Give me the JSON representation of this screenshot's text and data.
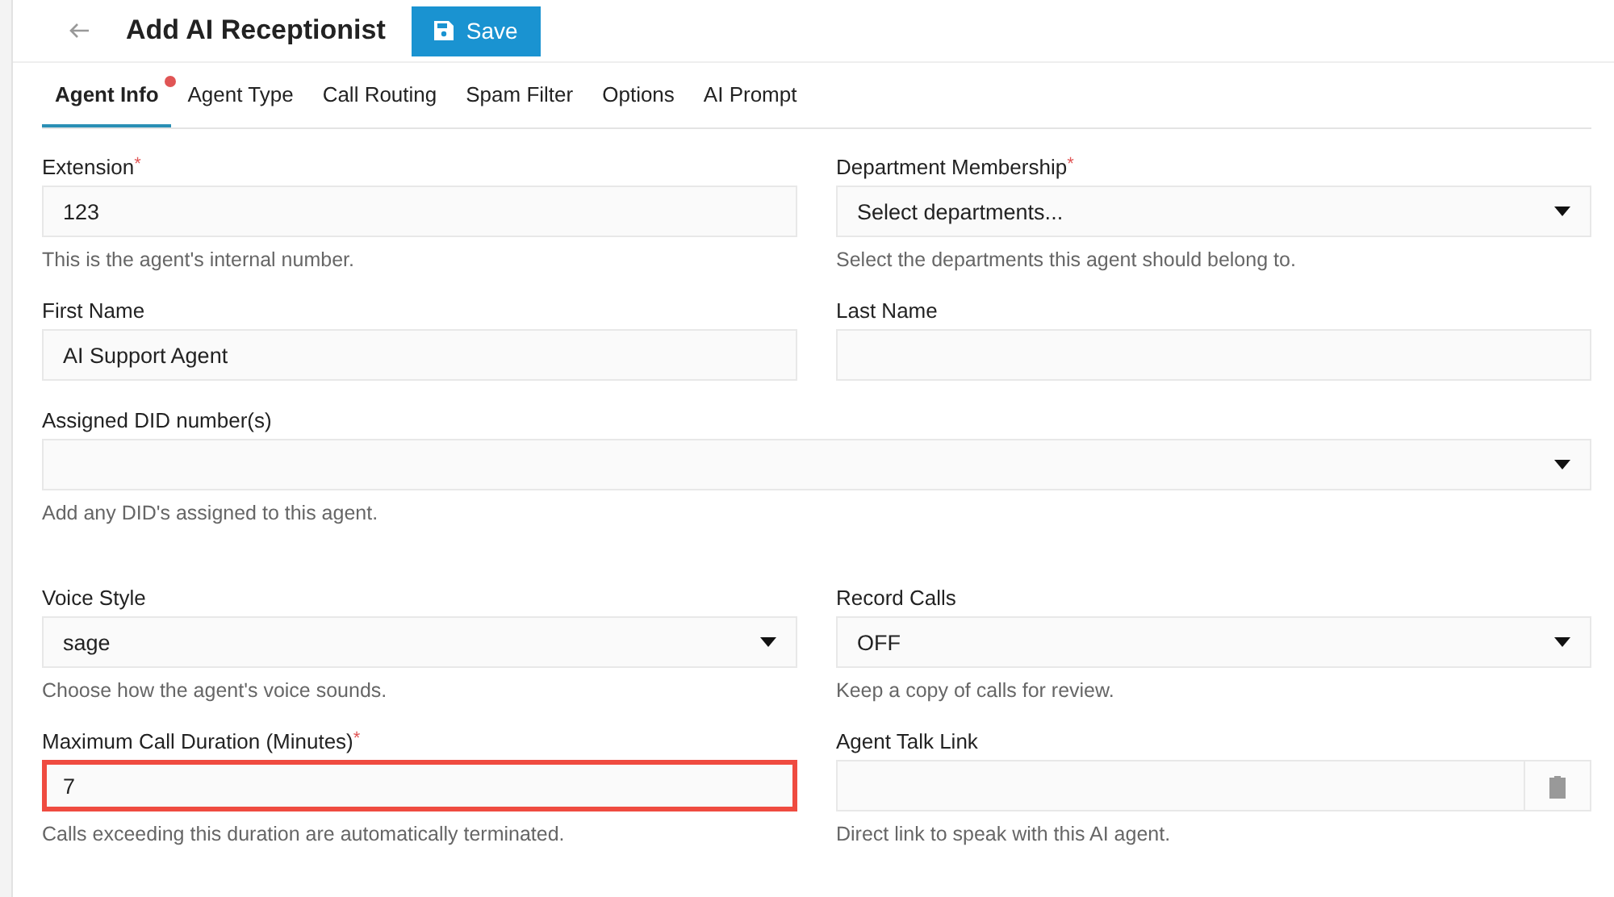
{
  "header": {
    "title": "Add AI Receptionist",
    "save_label": "Save"
  },
  "tabs": [
    {
      "label": "Agent Info",
      "selected": true,
      "alert": true
    },
    {
      "label": "Agent Type",
      "selected": false,
      "alert": false
    },
    {
      "label": "Call Routing",
      "selected": false,
      "alert": false
    },
    {
      "label": "Spam Filter",
      "selected": false,
      "alert": false
    },
    {
      "label": "Options",
      "selected": false,
      "alert": false
    },
    {
      "label": "AI Prompt",
      "selected": false,
      "alert": false
    }
  ],
  "rows": [
    {
      "fields": [
        {
          "kind": "input",
          "label": "Extension",
          "required_mark": "*",
          "value": "123",
          "help": "This is the agent's internal number.",
          "invalid": false
        },
        {
          "kind": "select",
          "label": "Department Membership",
          "required_mark": "*",
          "value": "Select departments...",
          "help": "Select the departments this agent should belong to.",
          "invalid": false
        }
      ]
    },
    {
      "fields": [
        {
          "kind": "input",
          "label": "First Name",
          "value": "AI Support Agent",
          "invalid": false
        },
        {
          "kind": "input",
          "label": "Last Name",
          "invalid": false
        }
      ]
    },
    {
      "fields": [
        {
          "kind": "select",
          "label": "Assigned DID number(s)",
          "help": "Add any DID's assigned to this agent.",
          "invalid": false
        }
      ]
    },
    {
      "fields": [
        {
          "kind": "select",
          "label": "Voice Style",
          "value": "sage",
          "help": "Choose how the agent's voice sounds.",
          "invalid": false
        },
        {
          "kind": "select",
          "label": "Record Calls",
          "value": "OFF",
          "help": "Keep a copy of calls for review.",
          "invalid": false
        }
      ]
    },
    {
      "fields": [
        {
          "kind": "input",
          "label": "Maximum Call Duration (Minutes)",
          "required_mark": "*",
          "value": "7",
          "help": "Calls exceeding this duration are automatically terminated.",
          "invalid": true
        },
        {
          "kind": "link",
          "label": "Agent Talk Link",
          "help": "Direct link to speak with this AI agent.",
          "invalid": false
        }
      ]
    }
  ]
}
